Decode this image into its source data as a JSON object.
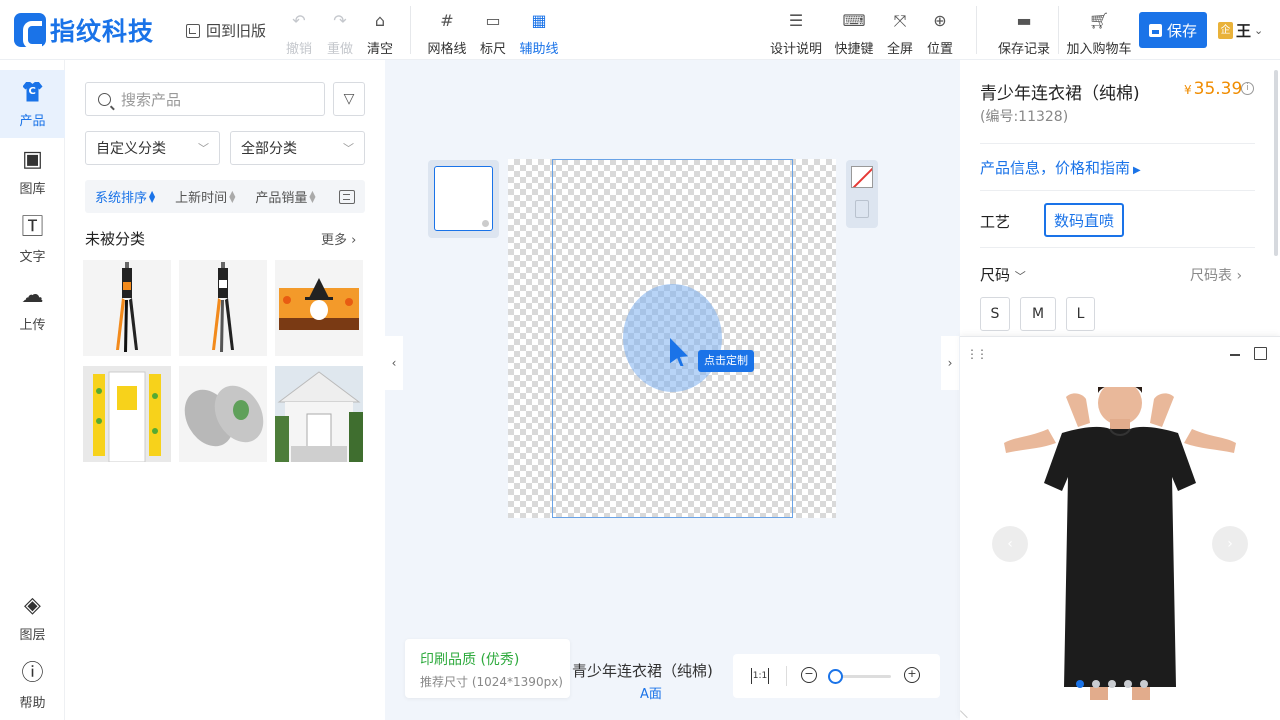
{
  "brand": {
    "name": "指纹科技",
    "color": "#1a73e8"
  },
  "header": {
    "back_old": "回到旧版",
    "tools_left": [
      {
        "label": "撤销",
        "icon": "undo-icon",
        "disabled": true
      },
      {
        "label": "重做",
        "icon": "redo-icon",
        "disabled": true
      },
      {
        "label": "清空",
        "icon": "clear-icon",
        "disabled": false
      }
    ],
    "tools_mid": [
      {
        "label": "网格线",
        "icon": "grid-icon"
      },
      {
        "label": "标尺",
        "icon": "ruler-icon"
      },
      {
        "label": "辅助线",
        "icon": "guide-icon",
        "active": true
      }
    ],
    "tools_right": [
      {
        "label": "设计说明",
        "icon": "instructions-icon"
      },
      {
        "label": "快捷键",
        "icon": "keyboard-icon"
      },
      {
        "label": "全屏",
        "icon": "fullscreen-icon"
      },
      {
        "label": "位置",
        "icon": "position-icon"
      }
    ],
    "save_record": "保存记录",
    "add_cart": "加入购物车",
    "save": "保存",
    "user_badge": "企",
    "user_name": "王"
  },
  "rail": {
    "items": [
      {
        "label": "产品",
        "icon": "shirt-icon",
        "active": true
      },
      {
        "label": "图库",
        "icon": "image-icon"
      },
      {
        "label": "文字",
        "icon": "text-icon"
      },
      {
        "label": "上传",
        "icon": "upload-icon"
      }
    ],
    "bottom": [
      {
        "label": "图层",
        "icon": "layers-icon"
      },
      {
        "label": "帮助",
        "icon": "help-icon"
      }
    ]
  },
  "products": {
    "search_placeholder": "搜索产品",
    "category_custom": "自定义分类",
    "category_all": "全部分类",
    "sorts": [
      "系统排序",
      "上新时间",
      "产品销量"
    ],
    "section_title": "未被分类",
    "more": "更多"
  },
  "canvas": {
    "click_tip": "点击定制",
    "quality_title": "印刷品质 (优秀)",
    "quality_size": "推荐尺寸 (1024*1390px)",
    "product_name": "青少年连衣裙（纯棉)",
    "side": "A面",
    "zoom_level": 0.05
  },
  "detail": {
    "title": "青少年连衣裙（纯棉)",
    "price_symbol": "¥",
    "price": "35.39",
    "code": "(编号:11328)",
    "info_link": "产品信息，价格和指南",
    "craft_label": "工艺",
    "craft_value": "数码直喷",
    "size_label": "尺码",
    "size_chart": "尺码表",
    "sizes": [
      "S",
      "M",
      "L"
    ]
  },
  "preview": {
    "dots": 5,
    "active_dot": 0
  }
}
